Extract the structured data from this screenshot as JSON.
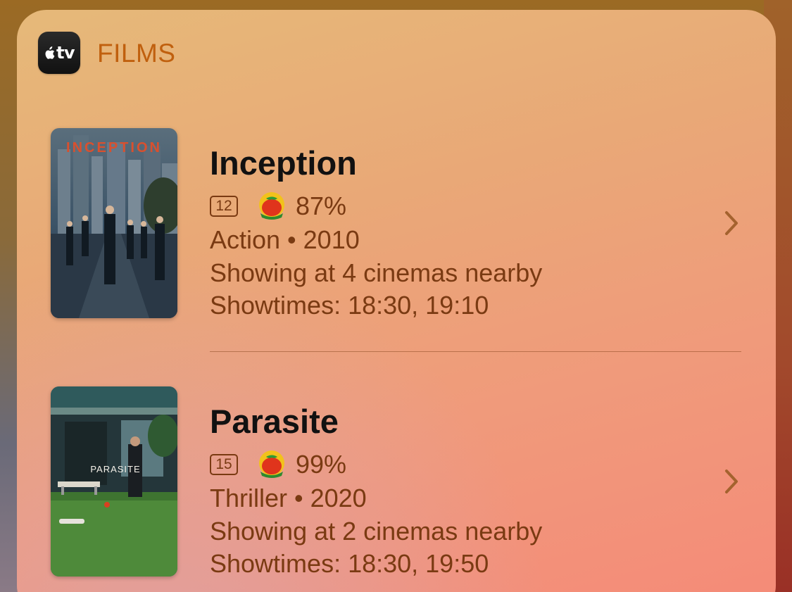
{
  "wallpaper": {
    "accent": "#9b6a24"
  },
  "widget": {
    "app_icon": "apple-tv-icon",
    "app_icon_text": "tv",
    "header": "FILMS",
    "accent_color": "#c0600e",
    "text_color": "#7a3a12"
  },
  "movies": [
    {
      "title": "Inception",
      "age_rating": "12",
      "rating_icon": "tomato-icon",
      "score": "87%",
      "genre_year": "Action • 2010",
      "cinemas": "Showing at 4 cinemas nearby",
      "showtimes": "Showtimes: 18:30, 19:10",
      "poster_text": "INCEPTION"
    },
    {
      "title": "Parasite",
      "age_rating": "15",
      "rating_icon": "tomato-icon",
      "score": "99%",
      "genre_year": "Thriller • 2020",
      "cinemas": "Showing at 2 cinemas nearby",
      "showtimes": "Showtimes: 18:30, 19:50",
      "poster_text": "PARASITE"
    }
  ]
}
